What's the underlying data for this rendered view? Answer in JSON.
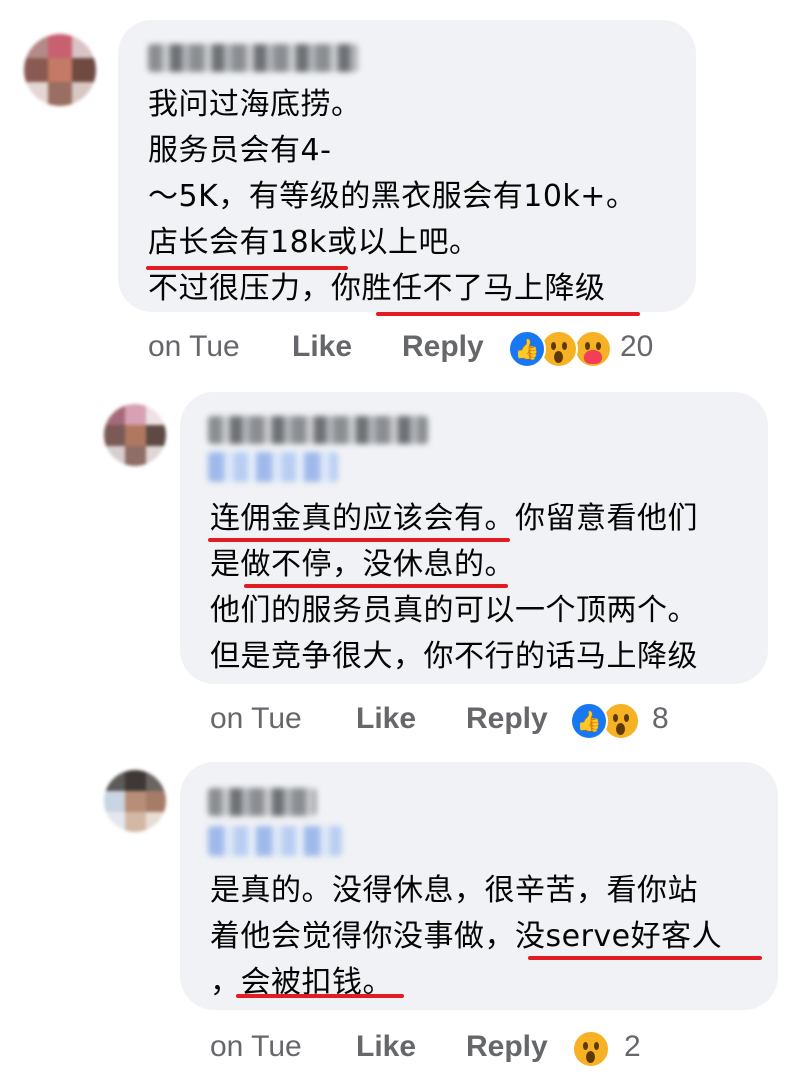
{
  "comments": [
    {
      "lines": [
        "我问过海底捞。",
        "服务员会有4-",
        "～5K，有等级的黑衣服会有10k+。",
        "店长会有18k或以上吧。",
        "不过很压力，你胜任不了马上降级"
      ],
      "time": "on Tue",
      "like_label": "Like",
      "reply_label": "Reply",
      "reaction_icons": [
        "like-icon",
        "wow-icon",
        "care-icon"
      ],
      "reaction_count": "20"
    },
    {
      "lines": [
        "连佣金真的应该会有。你留意看他们",
        "是做不停，没休息的。",
        "他们的服务员真的可以一个顶两个。",
        "但是竞争很大，你不行的话马上降级"
      ],
      "time": "on Tue",
      "like_label": "Like",
      "reply_label": "Reply",
      "reaction_icons": [
        "like-icon",
        "wow-icon"
      ],
      "reaction_count": "8"
    },
    {
      "lines": [
        "是真的。没得休息，很辛苦，看你站",
        "着他会觉得你没事做，没serve好客人",
        "，会被扣钱。"
      ],
      "time": "on Tue",
      "like_label": "Like",
      "reply_label": "Reply",
      "reaction_icons": [
        "wow-icon"
      ],
      "reaction_count": "2"
    }
  ],
  "colors": {
    "bubble": "#f0f2f5",
    "meta_text": "#65676b",
    "underline": "#e31b23",
    "like": "#1877f2",
    "wow": "#f7b125"
  }
}
